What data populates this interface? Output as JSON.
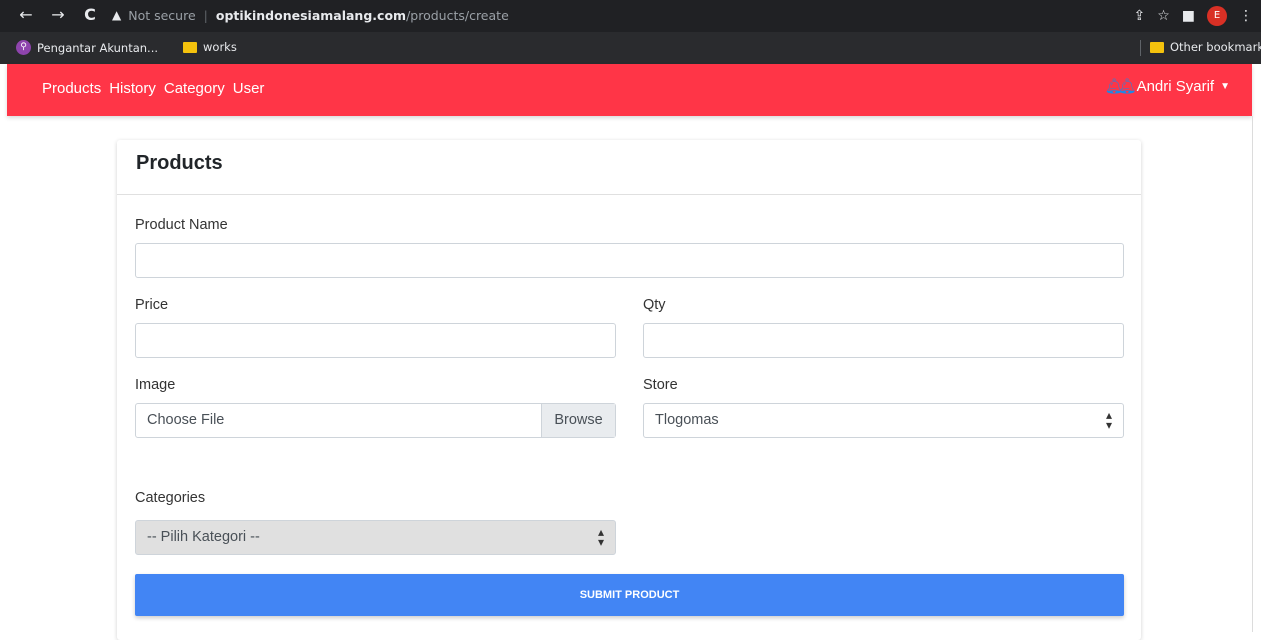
{
  "browser": {
    "back": "←",
    "forward": "→",
    "reload": "C",
    "security_label": "Not secure",
    "domain": "optikindonesiamalang.com",
    "path": "/products/create",
    "profile_initial": "E"
  },
  "bookmarks": {
    "item1": "Pengantar Akuntan...",
    "item2": "works",
    "other": "Other bookmarks"
  },
  "navbar": {
    "links": [
      "Products",
      "History",
      "Category",
      "User"
    ],
    "user_name": "Andri Syarif"
  },
  "colors": {
    "navbar": "#ff3547",
    "submit": "#4285f4",
    "bell": "#1e88e5"
  },
  "form": {
    "title": "Products",
    "product_name_label": "Product Name",
    "product_name_value": "",
    "price_label": "Price",
    "price_value": "",
    "qty_label": "Qty",
    "qty_value": "",
    "image_label": "Image",
    "file_placeholder": "Choose File",
    "browse_label": "Browse",
    "store_label": "Store",
    "store_selected": "Tlogomas",
    "categories_label": "Categories",
    "categories_selected": "-- Pilih Kategori --",
    "submit_label": "SUBMIT PRODUCT"
  },
  "icons": [
    "back-arrow-icon",
    "forward-arrow-icon",
    "reload-icon",
    "warning-icon",
    "share-icon",
    "star-icon",
    "sidebar-icon",
    "menu-dots-icon",
    "bell-icon",
    "caret-down-icon",
    "select-arrows-icon",
    "folder-icon"
  ]
}
